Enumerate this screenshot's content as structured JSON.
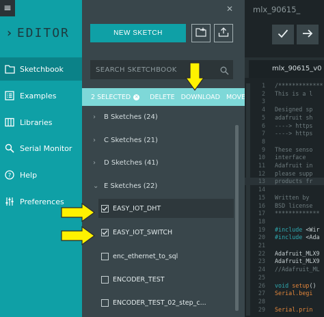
{
  "sidebar": {
    "brand": "EDITOR",
    "items": [
      {
        "label": "Sketchbook",
        "icon": "folder-icon",
        "active": true
      },
      {
        "label": "Examples",
        "icon": "list-icon",
        "active": false
      },
      {
        "label": "Libraries",
        "icon": "books-icon",
        "active": false
      },
      {
        "label": "Serial Monitor",
        "icon": "monitor-search-icon",
        "active": false
      },
      {
        "label": "Help",
        "icon": "question-circle-icon",
        "active": false
      },
      {
        "label": "Preferences",
        "icon": "sliders-icon",
        "active": false
      }
    ]
  },
  "sketchbook": {
    "new_sketch_label": "NEW SKETCH",
    "search_placeholder": "SEARCH SKETCHBOOK",
    "selection": {
      "count_label": "2 SELECTED",
      "actions": [
        "DELETE",
        "DOWNLOAD",
        "MOVE"
      ]
    },
    "folders": [
      {
        "label": "B Sketches (24)",
        "expanded": false
      },
      {
        "label": "C Sketches (21)",
        "expanded": false
      },
      {
        "label": "D Sketches (41)",
        "expanded": false
      },
      {
        "label": "E Sketches (22)",
        "expanded": true
      }
    ],
    "files": [
      {
        "name": "EASY_IOT_DHT",
        "checked": true
      },
      {
        "name": "EASY_IOT_SWITCH",
        "checked": true
      },
      {
        "name": "enc_ethernet_to_sql",
        "checked": false
      },
      {
        "name": "ENCODER_TEST",
        "checked": false
      },
      {
        "name": "ENCODER_TEST_02_step_c...",
        "checked": false
      },
      {
        "name": "...",
        "checked": false
      }
    ]
  },
  "editor": {
    "sketch_title": "mlx_90615_",
    "tab_label": "mlx_90615_v0",
    "code_lines": [
      {
        "n": "1",
        "t": "/*************"
      },
      {
        "n": "2",
        "t": "  This is a l"
      },
      {
        "n": "3",
        "t": ""
      },
      {
        "n": "4",
        "t": "  Designed sp"
      },
      {
        "n": "5",
        "t": "  adafruit sh"
      },
      {
        "n": "6",
        "t": "  ----> https"
      },
      {
        "n": "7",
        "t": "  ----> https"
      },
      {
        "n": "8",
        "t": ""
      },
      {
        "n": "9",
        "t": "  These senso"
      },
      {
        "n": "10",
        "t": "  interface"
      },
      {
        "n": "11",
        "t": "  Adafruit in"
      },
      {
        "n": "12",
        "t": "  please supp"
      },
      {
        "n": "13",
        "t": "  products fr"
      },
      {
        "n": "14",
        "t": ""
      },
      {
        "n": "15",
        "t": "  Written by"
      },
      {
        "n": "16",
        "t": "  BSD license"
      },
      {
        "n": "17",
        "t": " *************"
      },
      {
        "n": "18",
        "t": ""
      },
      {
        "n": "19",
        "t": "#include <Wir"
      },
      {
        "n": "20",
        "t": "#include <Ada"
      },
      {
        "n": "21",
        "t": ""
      },
      {
        "n": "22",
        "t": "Adafruit_MLX9"
      },
      {
        "n": "23",
        "t": "Adafruit_MLX9"
      },
      {
        "n": "24",
        "t": "//Adafruit_ML"
      },
      {
        "n": "25",
        "t": ""
      },
      {
        "n": "26",
        "t": "void setup()"
      },
      {
        "n": "27",
        "t": "  Serial.begi"
      },
      {
        "n": "28",
        "t": ""
      },
      {
        "n": "29",
        "t": "  Serial.prin"
      }
    ]
  },
  "colors": {
    "teal": "#0fa0a6",
    "selection_bar": "#7ed8d8",
    "panel": "#39464b",
    "annotation": "#fff200"
  }
}
